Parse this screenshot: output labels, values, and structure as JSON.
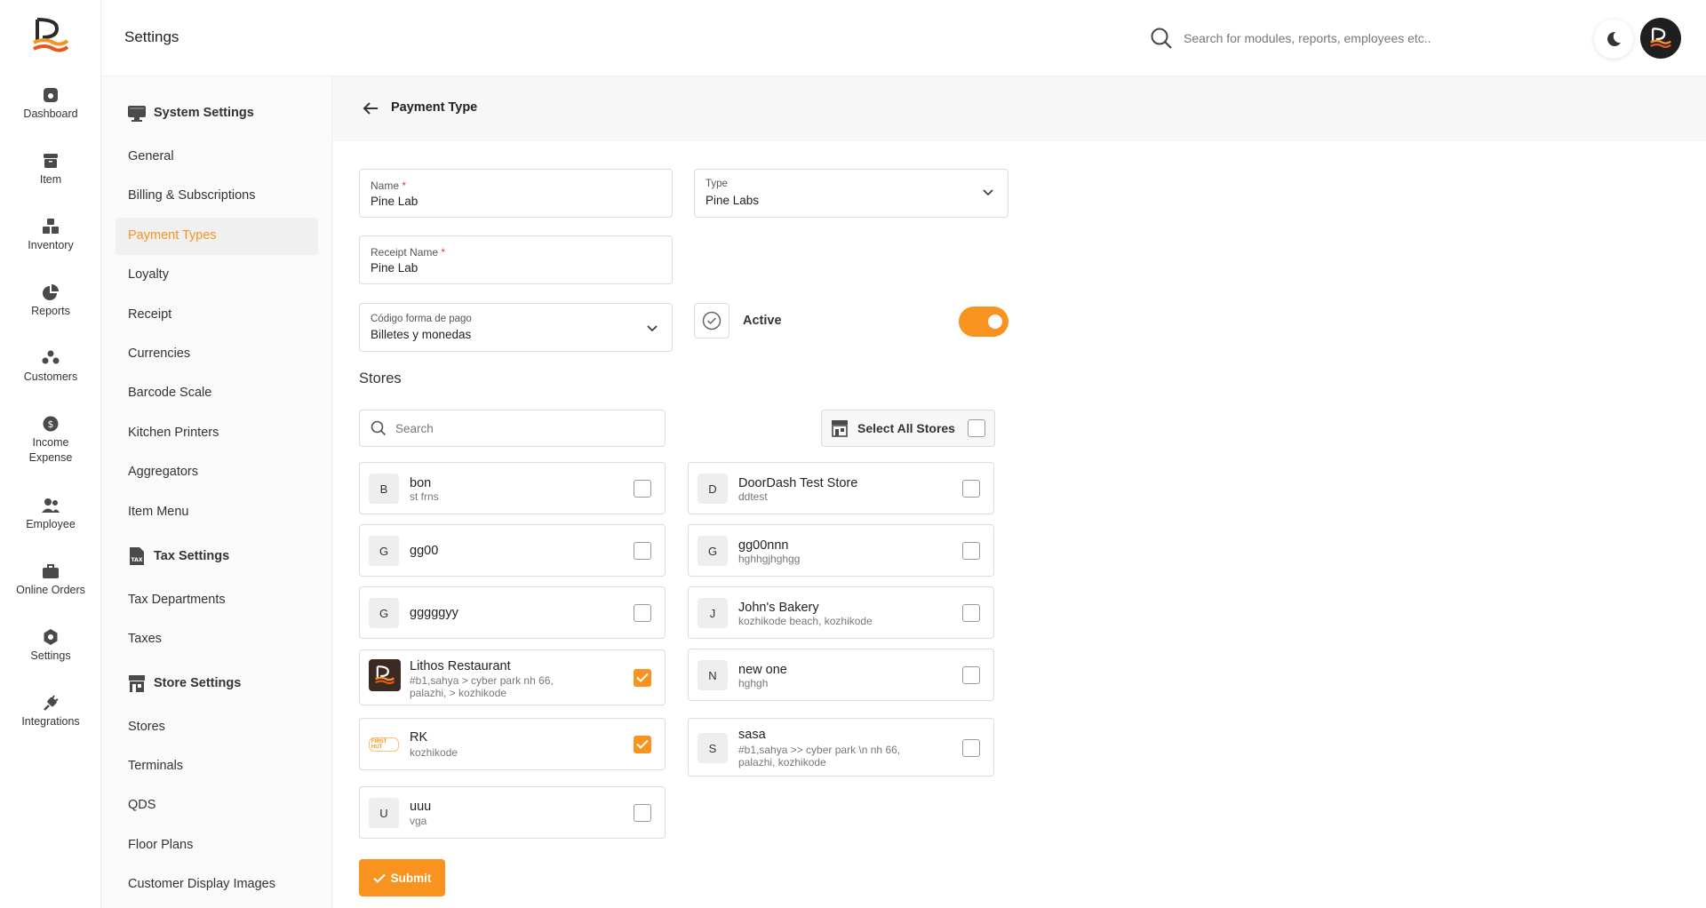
{
  "app": {
    "title": "Settings"
  },
  "header": {
    "search_placeholder": "Search for modules, reports, employees etc.."
  },
  "rail": [
    {
      "label": "Dashboard",
      "icon": "dashboard-icon"
    },
    {
      "label": "Item",
      "icon": "item-icon"
    },
    {
      "label": "Inventory",
      "icon": "inventory-icon"
    },
    {
      "label": "Reports",
      "icon": "reports-icon"
    },
    {
      "label": "Customers",
      "icon": "customers-icon"
    },
    {
      "label": "Income Expense",
      "icon": "income-expense-icon"
    },
    {
      "label": "Employee",
      "icon": "employee-icon"
    },
    {
      "label": "Online Orders",
      "icon": "online-orders-icon"
    },
    {
      "label": "Settings",
      "icon": "settings-icon"
    },
    {
      "label": "Integrations",
      "icon": "integrations-icon"
    }
  ],
  "menu": {
    "system_title": "System Settings",
    "system_items": [
      "General",
      "Billing & Subscriptions",
      "Payment Types",
      "Loyalty",
      "Receipt",
      "Currencies",
      "Barcode Scale",
      "Kitchen Printers",
      "Aggregators",
      "Item Menu"
    ],
    "tax_title": "Tax Settings",
    "tax_items": [
      "Tax Departments",
      "Taxes"
    ],
    "store_title": "Store Settings",
    "store_items": [
      "Stores",
      "Terminals",
      "QDS",
      "Floor Plans",
      "Customer Display Images"
    ],
    "active_item": "Payment Types"
  },
  "page": {
    "title": "Payment Type",
    "name_label": "Name",
    "name_value": "Pine Lab",
    "type_label": "Type",
    "type_value": "Pine Labs",
    "receipt_label": "Receipt Name",
    "receipt_value": "Pine Lab",
    "codigo_label": "Código forma de pago",
    "codigo_value": "Billetes y monedas",
    "active_label": "Active",
    "active_on": true,
    "required_mark": "*",
    "stores_title": "Stores",
    "store_search_placeholder": "Search",
    "select_all_label": "Select All Stores",
    "submit_label": "Submit"
  },
  "stores_left": [
    {
      "initial": "B",
      "name": "bon",
      "address": "st frns",
      "checked": false
    },
    {
      "initial": "G",
      "name": "gg00",
      "address": "",
      "checked": false
    },
    {
      "initial": "G",
      "name": "gggggyy",
      "address": "",
      "checked": false
    },
    {
      "initial": "",
      "name": "Lithos Restaurant",
      "address": "#b1,sahya > cyber park nh 66,",
      "address2": "palazhi, > kozhikode",
      "checked": true,
      "logo": "lithos-logo"
    },
    {
      "initial": "",
      "name": "RK",
      "address": "kozhikode",
      "checked": true,
      "logo": "rk-logo",
      "logo_text": "FIRST HUT"
    },
    {
      "initial": "U",
      "name": "uuu",
      "address": "vga",
      "checked": false
    }
  ],
  "stores_right": [
    {
      "initial": "D",
      "name": "DoorDash Test Store",
      "address": "ddtest",
      "checked": false
    },
    {
      "initial": "G",
      "name": "gg00nnn",
      "address": "hghhgjhghgg",
      "checked": false
    },
    {
      "initial": "J",
      "name": "John's Bakery",
      "address": "kozhikode beach, kozhikode",
      "checked": false
    },
    {
      "initial": "N",
      "name": "new one",
      "address": "hghgh",
      "checked": false
    },
    {
      "initial": "S",
      "name": "sasa",
      "address": "#b1,sahya >> cyber park \\n nh 66,",
      "address2": "palazhi, kozhikode",
      "checked": false
    }
  ],
  "colors": {
    "accent": "#f7931e",
    "text": "#222222",
    "muted": "#777777"
  }
}
